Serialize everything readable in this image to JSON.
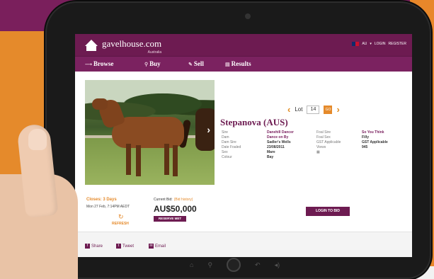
{
  "site": {
    "logo_name": "gavelhouse.com",
    "logo_region": "Australia",
    "region": "AU",
    "login": "LOGIN",
    "register": "REGISTER"
  },
  "nav": {
    "browse": "Browse",
    "buy": "Buy",
    "sell": "Sell",
    "results": "Results"
  },
  "lot": {
    "label": "Lot",
    "number": "14",
    "go": "GO"
  },
  "horse": {
    "name": "Stepanova (AUS)"
  },
  "details_left": {
    "labels": [
      "Sire",
      "Dam",
      "Dam Sire",
      "Date Foaled",
      "Sex",
      "Colour"
    ],
    "values": [
      "Danehill Dancer",
      "Dance on By",
      "Sadler's Wells",
      "23/08/2011",
      "Mare",
      "Bay"
    ]
  },
  "details_right": {
    "labels": [
      "Foal Sire",
      "Foal Sex",
      "GST Applicable",
      "Views"
    ],
    "values": [
      "So You Think",
      "Filly",
      "GST Applicable",
      "945"
    ]
  },
  "bidding": {
    "closes": "Closes: 3 Days",
    "close_date": "Mon 27 Feb, 7:14PM AEDT",
    "refresh": "REFRESH",
    "current_bid_label": "Current Bid:",
    "bid_history": "(Bid history)",
    "amount": "AU$50,000",
    "reserve": "RESERVE MET",
    "login_to_bid": "LOGIN TO BID"
  },
  "share": {
    "share": "Share",
    "tweet": "Tweet",
    "email": "Email"
  },
  "colors": {
    "brand": "#6d1b51",
    "accent": "#e58a2b"
  }
}
